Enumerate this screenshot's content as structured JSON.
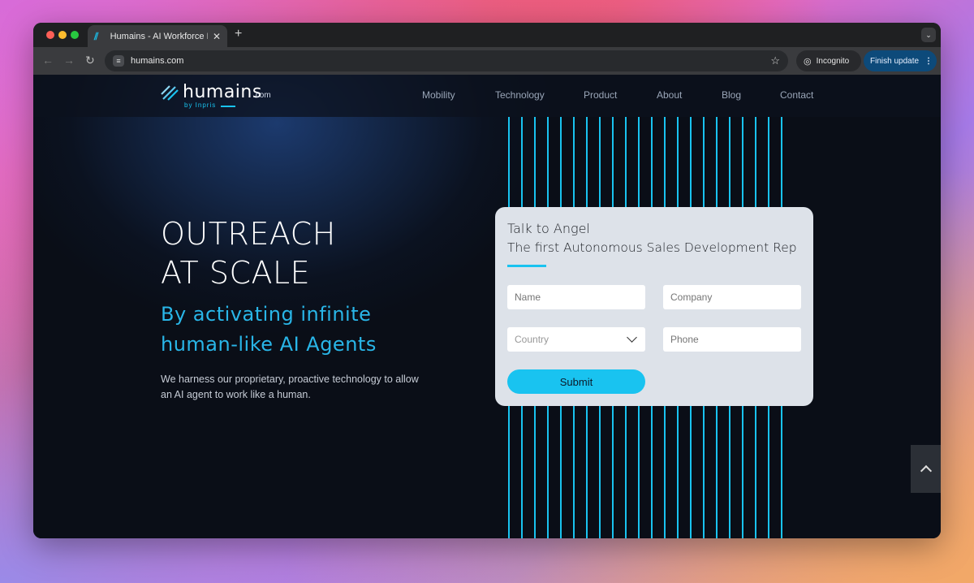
{
  "browser": {
    "tab_title": "Humains - AI Workforce Revo",
    "tab_close": "✕",
    "new_tab": "+",
    "url": "humains.com",
    "incognito_label": "Incognito",
    "finish_update_label": "Finish update"
  },
  "site": {
    "logo": {
      "word": "humains",
      "suffix": ".com",
      "byline": "by Inpris"
    },
    "nav": [
      "Mobility",
      "Technology",
      "Product",
      "About",
      "Blog",
      "Contact"
    ],
    "hero": {
      "title_line1": "OUTREACH",
      "title_line2": "AT SCALE",
      "subtitle_line1": "By activating infinite",
      "subtitle_line2": "human-like AI Agents",
      "description": "We harness our proprietary, proactive technology to allow an AI agent to work like a human."
    },
    "form": {
      "title": "Talk to Angel",
      "subtitle": "The first Autonomous Sales Development Rep",
      "name_placeholder": "Name",
      "company_placeholder": "Company",
      "country_placeholder": "Country",
      "phone_placeholder": "Phone",
      "submit_label": "Submit"
    }
  },
  "colors": {
    "accent": "#19c3f0",
    "background": "#0a0e17",
    "card": "#dde2e9"
  }
}
